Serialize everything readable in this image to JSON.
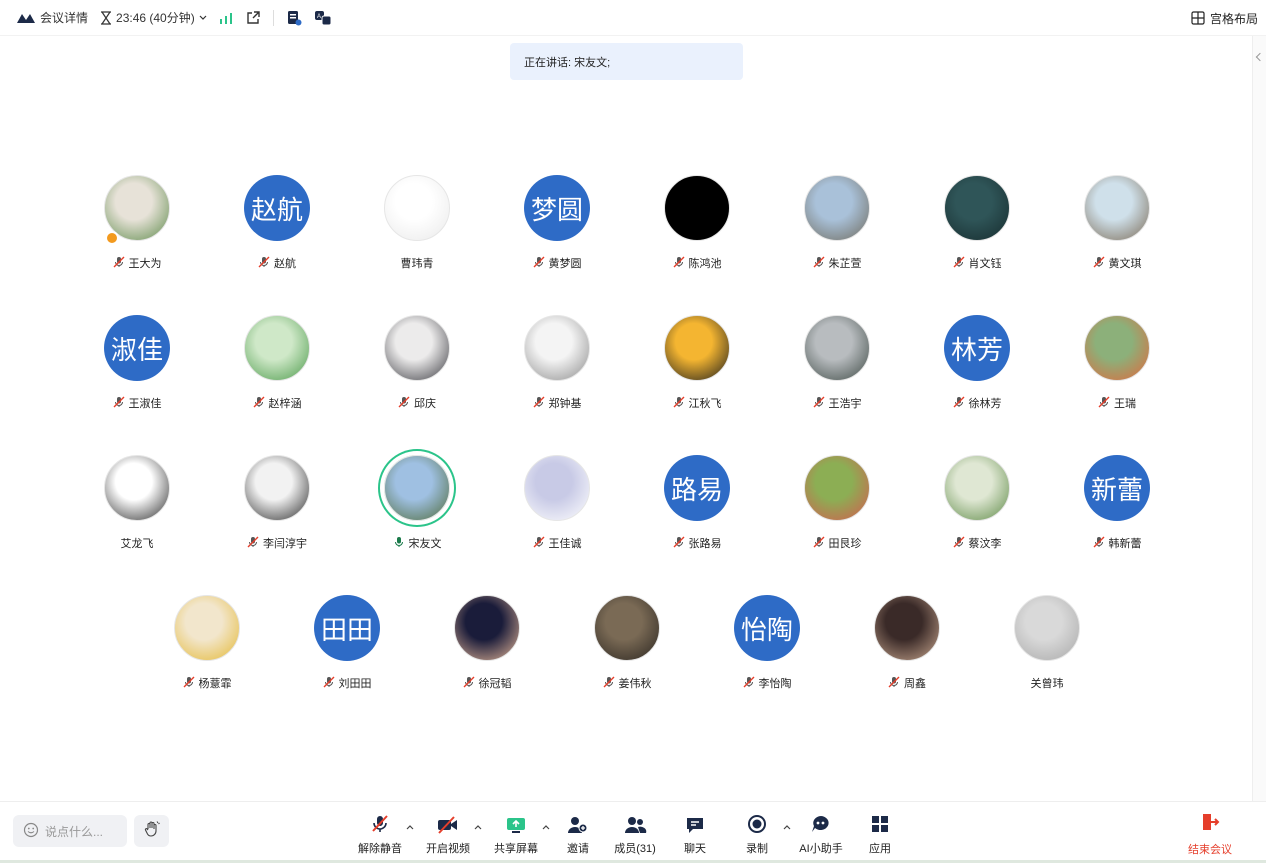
{
  "topbar": {
    "meeting_details": "会议详情",
    "timer": "23:46 (40分钟)",
    "layout_label": "宫格布局"
  },
  "speaking_banner": "正在讲话: 宋友文;",
  "colors": {
    "avatar_blue": "#2e6bc6",
    "active_ring": "#2bc48a",
    "end_red": "#e53e2b",
    "host_badge": "#f39a1e"
  },
  "participants": [
    {
      "name": "王大为",
      "avatar_text": "",
      "muted": true,
      "host": true,
      "photo_colors": [
        "#e7e2d8",
        "#5d8a4a"
      ]
    },
    {
      "name": "赵航",
      "avatar_text": "赵航",
      "muted": true
    },
    {
      "name": "曹玮青",
      "avatar_text": "",
      "muted": false,
      "photo_colors": [
        "#ffffff",
        "#e9e9e9"
      ]
    },
    {
      "name": "黄梦圆",
      "avatar_text": "梦圆",
      "muted": true
    },
    {
      "name": "陈鸿池",
      "avatar_text": "",
      "muted": true,
      "photo_colors": [
        "#000000",
        "#000000"
      ]
    },
    {
      "name": "朱芷萱",
      "avatar_text": "",
      "muted": true,
      "photo_colors": [
        "#a9c1d9",
        "#6e6a5d"
      ]
    },
    {
      "name": "肖文钰",
      "avatar_text": "",
      "muted": true,
      "photo_colors": [
        "#2f5558",
        "#162b2d"
      ]
    },
    {
      "name": "黄文琪",
      "avatar_text": "",
      "muted": true,
      "photo_colors": [
        "#cfe0ea",
        "#7a6a55"
      ]
    },
    {
      "name": "王淑佳",
      "avatar_text": "淑佳",
      "muted": true
    },
    {
      "name": "赵梓涵",
      "avatar_text": "",
      "muted": true,
      "photo_colors": [
        "#cfe8c8",
        "#4b9a4a"
      ]
    },
    {
      "name": "邱庆",
      "avatar_text": "",
      "muted": true,
      "photo_colors": [
        "#ecebeb",
        "#3a3a40"
      ]
    },
    {
      "name": "郑钟基",
      "avatar_text": "",
      "muted": true,
      "photo_colors": [
        "#f4f4f4",
        "#8b8b8b"
      ]
    },
    {
      "name": "江秋飞",
      "avatar_text": "",
      "muted": true,
      "photo_colors": [
        "#f4b531",
        "#1b1b1b"
      ]
    },
    {
      "name": "王浩宇",
      "avatar_text": "",
      "muted": true,
      "photo_colors": [
        "#b8bcbf",
        "#3d4944"
      ]
    },
    {
      "name": "徐林芳",
      "avatar_text": "林芳",
      "muted": true
    },
    {
      "name": "王瑞",
      "avatar_text": "",
      "muted": true,
      "photo_colors": [
        "#8cb07a",
        "#e3673a"
      ]
    },
    {
      "name": "艾龙飞",
      "avatar_text": "",
      "muted": false,
      "photo_colors": [
        "#ffffff",
        "#2a2a2a"
      ]
    },
    {
      "name": "李闫淳宇",
      "avatar_text": "",
      "muted": true,
      "photo_colors": [
        "#f2f2f2",
        "#2a2a2a"
      ]
    },
    {
      "name": "宋友文",
      "avatar_text": "",
      "muted": false,
      "speaking": true,
      "photo_colors": [
        "#9fc0e2",
        "#4e6a3a"
      ]
    },
    {
      "name": "王佳诚",
      "avatar_text": "",
      "muted": true,
      "photo_colors": [
        "#c8cae6",
        "#ffffff"
      ]
    },
    {
      "name": "张路易",
      "avatar_text": "路易",
      "muted": true
    },
    {
      "name": "田艮珍",
      "avatar_text": "",
      "muted": true,
      "photo_colors": [
        "#8cae54",
        "#d65a4f"
      ]
    },
    {
      "name": "蔡汶李",
      "avatar_text": "",
      "muted": true,
      "photo_colors": [
        "#dfe7d3",
        "#5d8a46"
      ]
    },
    {
      "name": "韩新蕾",
      "avatar_text": "新蕾",
      "muted": true
    },
    {
      "name": "杨薏霏",
      "avatar_text": "",
      "muted": true,
      "photo_colors": [
        "#f2e6cc",
        "#e4b833"
      ]
    },
    {
      "name": "刘田田",
      "avatar_text": "田田",
      "muted": true
    },
    {
      "name": "徐冠韬",
      "avatar_text": "",
      "muted": true,
      "photo_colors": [
        "#1a1c3a",
        "#e8b99a"
      ]
    },
    {
      "name": "姜伟秋",
      "avatar_text": "",
      "muted": true,
      "photo_colors": [
        "#7a6a55",
        "#2a2520"
      ]
    },
    {
      "name": "李怡陶",
      "avatar_text": "怡陶",
      "muted": true
    },
    {
      "name": "周鑫",
      "avatar_text": "",
      "muted": true,
      "photo_colors": [
        "#3a2a28",
        "#c9a78f"
      ]
    },
    {
      "name": "关曾玮",
      "avatar_text": "",
      "muted": false,
      "photo_colors": [
        "#d9d9d9",
        "#a8a8a8"
      ]
    }
  ],
  "bottombar": {
    "chat_placeholder": "说点什么...",
    "tools": [
      {
        "label": "解除静音",
        "icon": "mic-muted-icon"
      },
      {
        "label": "开启视频",
        "icon": "camera-off-icon"
      },
      {
        "label": "共享屏幕",
        "icon": "share-screen-icon"
      },
      {
        "label": "邀请",
        "icon": "invite-user-icon"
      },
      {
        "label": "成员(31)",
        "icon": "members-icon"
      },
      {
        "label": "聊天",
        "icon": "chat-icon"
      },
      {
        "label": "录制",
        "icon": "record-icon"
      },
      {
        "label": "AI小助手",
        "icon": "ai-assistant-icon"
      },
      {
        "label": "应用",
        "icon": "apps-icon"
      }
    ],
    "end_label": "结束会议"
  }
}
